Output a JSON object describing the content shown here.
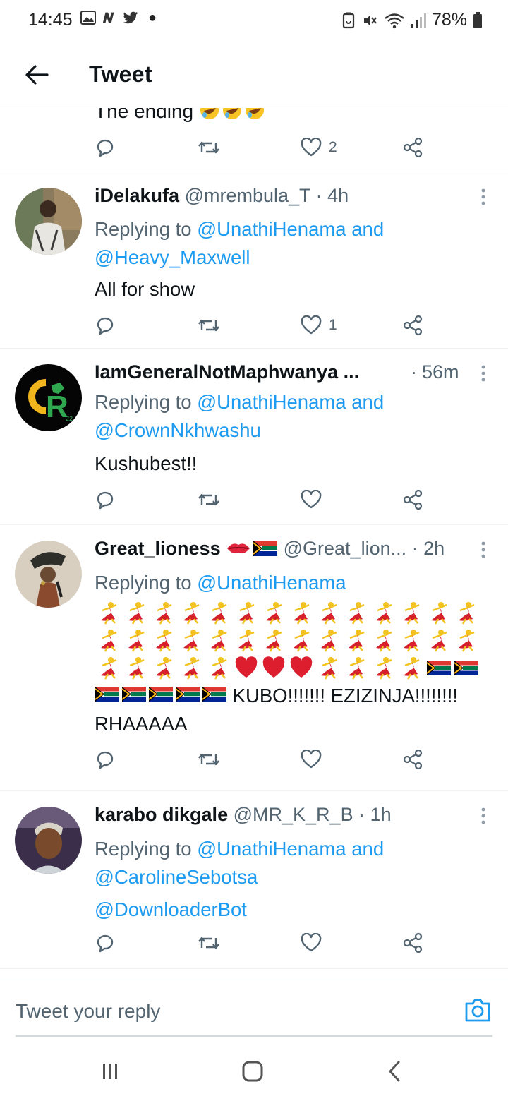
{
  "status_bar": {
    "time": "14:45",
    "battery": "78%",
    "left_icons": [
      "gallery-icon",
      "n-app-icon",
      "twitter-bird-icon"
    ],
    "right_icons": [
      "battery-saver-icon",
      "mute-icon",
      "wifi-icon",
      "signal-icon",
      "battery-icon"
    ]
  },
  "header": {
    "back_icon": "arrow-left-icon",
    "title": "Tweet"
  },
  "partial_tweet": {
    "text": "The ending",
    "emoji": "rolling-on-floor-laughing x3",
    "replies": "",
    "retweets": "",
    "likes": "2"
  },
  "tweets": [
    {
      "name": "iDelakufa",
      "handle": "@mrembula_T",
      "separator": "·",
      "time": "4h",
      "replying_prefix": "Replying to ",
      "replying_to": [
        "@UnathiHenama",
        "@Heavy_Maxwell"
      ],
      "replying_joiner": " and",
      "text": "All for show",
      "likes": "1"
    },
    {
      "name": "IamGeneralNotMaphwanya ...",
      "handle": "",
      "separator": "·",
      "time": "56m",
      "replying_prefix": "Replying to ",
      "replying_to": [
        "@UnathiHenama",
        "@CrownNkhwashu"
      ],
      "replying_joiner": " and",
      "text": "Kushubest!!",
      "likes": "",
      "avatar_text": "R",
      "avatar_sub": "22"
    },
    {
      "name": "Great_lioness",
      "name_emoji": [
        "kiss-mark-lips",
        "south-africa-flag"
      ],
      "handle": "@Great_lion...",
      "separator": "·",
      "time": "2h",
      "replying_prefix": "Replying to ",
      "replying_to": [
        "@UnathiHenama"
      ],
      "emoji_rows": [
        [
          "dancer",
          "dancer",
          "dancer",
          "dancer",
          "dancer",
          "dancer",
          "dancer",
          "dancer",
          "dancer",
          "dancer",
          "dancer",
          "dancer",
          "dancer",
          "dancer"
        ],
        [
          "dancer",
          "dancer",
          "dancer",
          "dancer",
          "dancer",
          "dancer",
          "dancer",
          "dancer",
          "dancer",
          "dancer",
          "dancer",
          "dancer",
          "dancer",
          "dancer"
        ],
        [
          "dancer",
          "dancer",
          "dancer",
          "dancer",
          "dancer",
          "heart",
          "heart",
          "heart",
          "dancer",
          "dancer",
          "dancer",
          "dancer",
          "flag",
          "flag"
        ]
      ],
      "text_line1": "KUBO!!!!!!! EZIZINJA!!!!!!!!",
      "text_line1_prefix_flags": 5,
      "text_line2": "RHAAAAA",
      "likes": ""
    },
    {
      "name": "karabo dikgale",
      "handle": "@MR_K_R_B",
      "separator": "·",
      "time": "1h",
      "replying_prefix": "Replying to ",
      "replying_to": [
        "@UnathiHenama",
        "@CarolineSebotsa"
      ],
      "replying_joiner": " and",
      "text": "@DownloaderBot",
      "likes": ""
    }
  ],
  "composer": {
    "placeholder": "Tweet your reply",
    "camera_icon": "camera-icon"
  },
  "nav": {
    "recent_icon": "recent-apps-icon",
    "home_icon": "home-icon",
    "back_icon": "nav-back-icon"
  },
  "colors": {
    "accent": "#1d9bf0",
    "text": "#0f1419",
    "secondary": "#536471",
    "divider": "#eff3f4"
  }
}
